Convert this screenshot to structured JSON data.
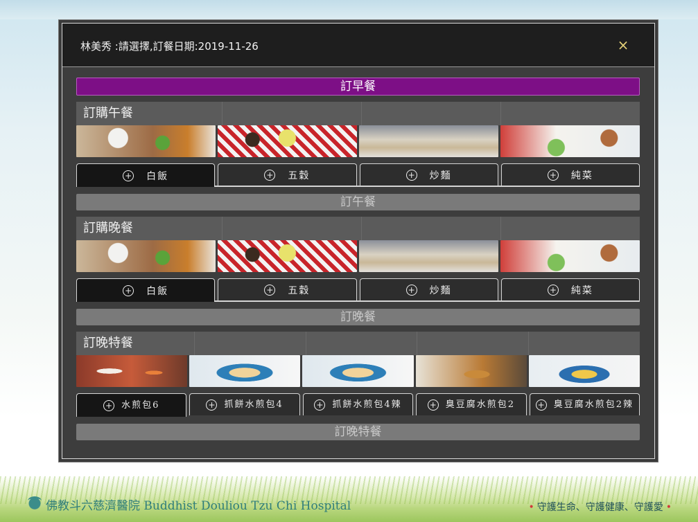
{
  "modal": {
    "title": "林美秀 :請選擇,訂餐日期:2019-11-26",
    "close_label": "×"
  },
  "breakfast": {
    "order_label": "訂早餐"
  },
  "lunch": {
    "title": "訂購午餐",
    "options": [
      "白飯",
      "五穀",
      "炒麵",
      "純菜"
    ],
    "order_label": "訂午餐"
  },
  "dinner": {
    "title": "訂購晚餐",
    "options": [
      "白飯",
      "五穀",
      "炒麵",
      "純菜"
    ],
    "order_label": "訂晚餐"
  },
  "special": {
    "title": "訂晚特餐",
    "options": [
      "水煎包6",
      "抓餅水煎包4",
      "抓餅水煎包4辣",
      "臭豆腐水煎包2",
      "臭豆腐水煎包2辣"
    ],
    "order_label": "訂晚特餐"
  },
  "background": {
    "hospital_name": "佛教斗六慈濟醫院  Buddhist  Douliou Tzu Chi Hospital",
    "slogan": "守護生命、守護健康、守護愛"
  },
  "colors": {
    "active_order": "#7d0f86",
    "inactive_order": "#7a7a7a",
    "close_icon": "#e6d27a"
  }
}
